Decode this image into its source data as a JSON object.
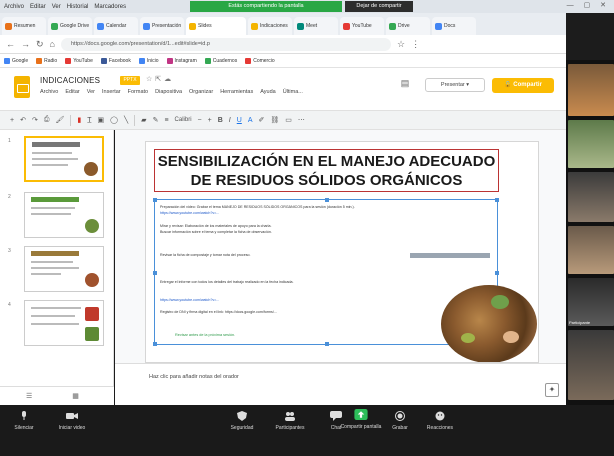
{
  "browser": {
    "menu_items": [
      "Archivo",
      "Editar",
      "Ver",
      "Historial",
      "Marcadores",
      "Perfiles",
      "Pestaña",
      "Ventana",
      "Ayuda"
    ],
    "share_banner": "Estás compartiendo la pantalla",
    "stop_share": "Dejar de compartir",
    "tabs": [
      {
        "label": "Resumen",
        "color": "#e8711a"
      },
      {
        "label": "Google Drive",
        "color": "#34a853"
      },
      {
        "label": "Calendar",
        "color": "#4285f4"
      },
      {
        "label": "Presentación",
        "color": "#4285f4"
      },
      {
        "label": "Slides",
        "color": "#f4b400"
      },
      {
        "label": "Indicaciones",
        "color": "#f4b400"
      },
      {
        "label": "Meet",
        "color": "#00897b"
      },
      {
        "label": "YouTube",
        "color": "#e53935"
      },
      {
        "label": "Drive",
        "color": "#34a853"
      },
      {
        "label": "Docs",
        "color": "#4285f4"
      }
    ],
    "url": "https://docs.google.com/presentation/d/1...edit#slide=id.p",
    "bookmarks": [
      {
        "label": "Google",
        "color": "#4285f4"
      },
      {
        "label": "Radio",
        "color": "#e8711a"
      },
      {
        "label": "YouTube",
        "color": "#e53935"
      },
      {
        "label": "Facebook",
        "color": "#3b5998"
      },
      {
        "label": "Inicio",
        "color": "#4285f4"
      },
      {
        "label": "Instagram",
        "color": "#c13584"
      },
      {
        "label": "Cuadernos",
        "color": "#34a853"
      },
      {
        "label": "Comercio",
        "color": "#e53935"
      }
    ]
  },
  "app": {
    "doc_title": "INDICACIONES",
    "doc_badge": "PPTX",
    "menu": [
      "Archivo",
      "Editar",
      "Ver",
      "Insertar",
      "Formato",
      "Diapositiva",
      "Organizar",
      "Herramientas",
      "Ayuda",
      "Última..."
    ],
    "present_label": "Presentar",
    "share_label": "Compartir",
    "toolbar_font": "Calibri"
  },
  "filmstrip": {
    "slides": [
      1,
      2,
      3,
      4
    ]
  },
  "slide": {
    "title_line1": "SENSIBILIZACIÓN EN EL MANEJO ADECUADO",
    "title_line2": "DE RESIDUOS SÓLIDOS ORGÁNICOS",
    "paragraphs": [
      "Preparación del video: Grabar el tema MANEJO DE RESIDUOS SÓLIDOS ORGÁNICOS para la sesión (duración 5 min.).",
      "https://www.youtube.com/watch?v=...",
      "Mirar y revisar: Elaboración de los materiales de apoyo para la charla.",
      "Buscar información sobre el tema y completar la ficha de observación.",
      "Revisar la ficha de compostaje y tomar nota del proceso.",
      "Entregar el informe con todos los detalles del trabajo realizado en la fecha indicada.",
      "https://www.youtube.com/watch?v=...",
      "Registro de DNI y firma digital en el link: https://docs.google.com/forms/..."
    ],
    "green_note": "Revisar antes de la próxima sesión."
  },
  "notes": {
    "placeholder": "Haz clic para añadir notas del orador"
  },
  "zoom": {
    "controls": [
      "Silenciar",
      "Iniciar video",
      "Seguridad",
      "Participantes",
      "Chat",
      "Compartir pantalla",
      "Grabar",
      "Reacciones"
    ],
    "participant_name": "Participante"
  }
}
